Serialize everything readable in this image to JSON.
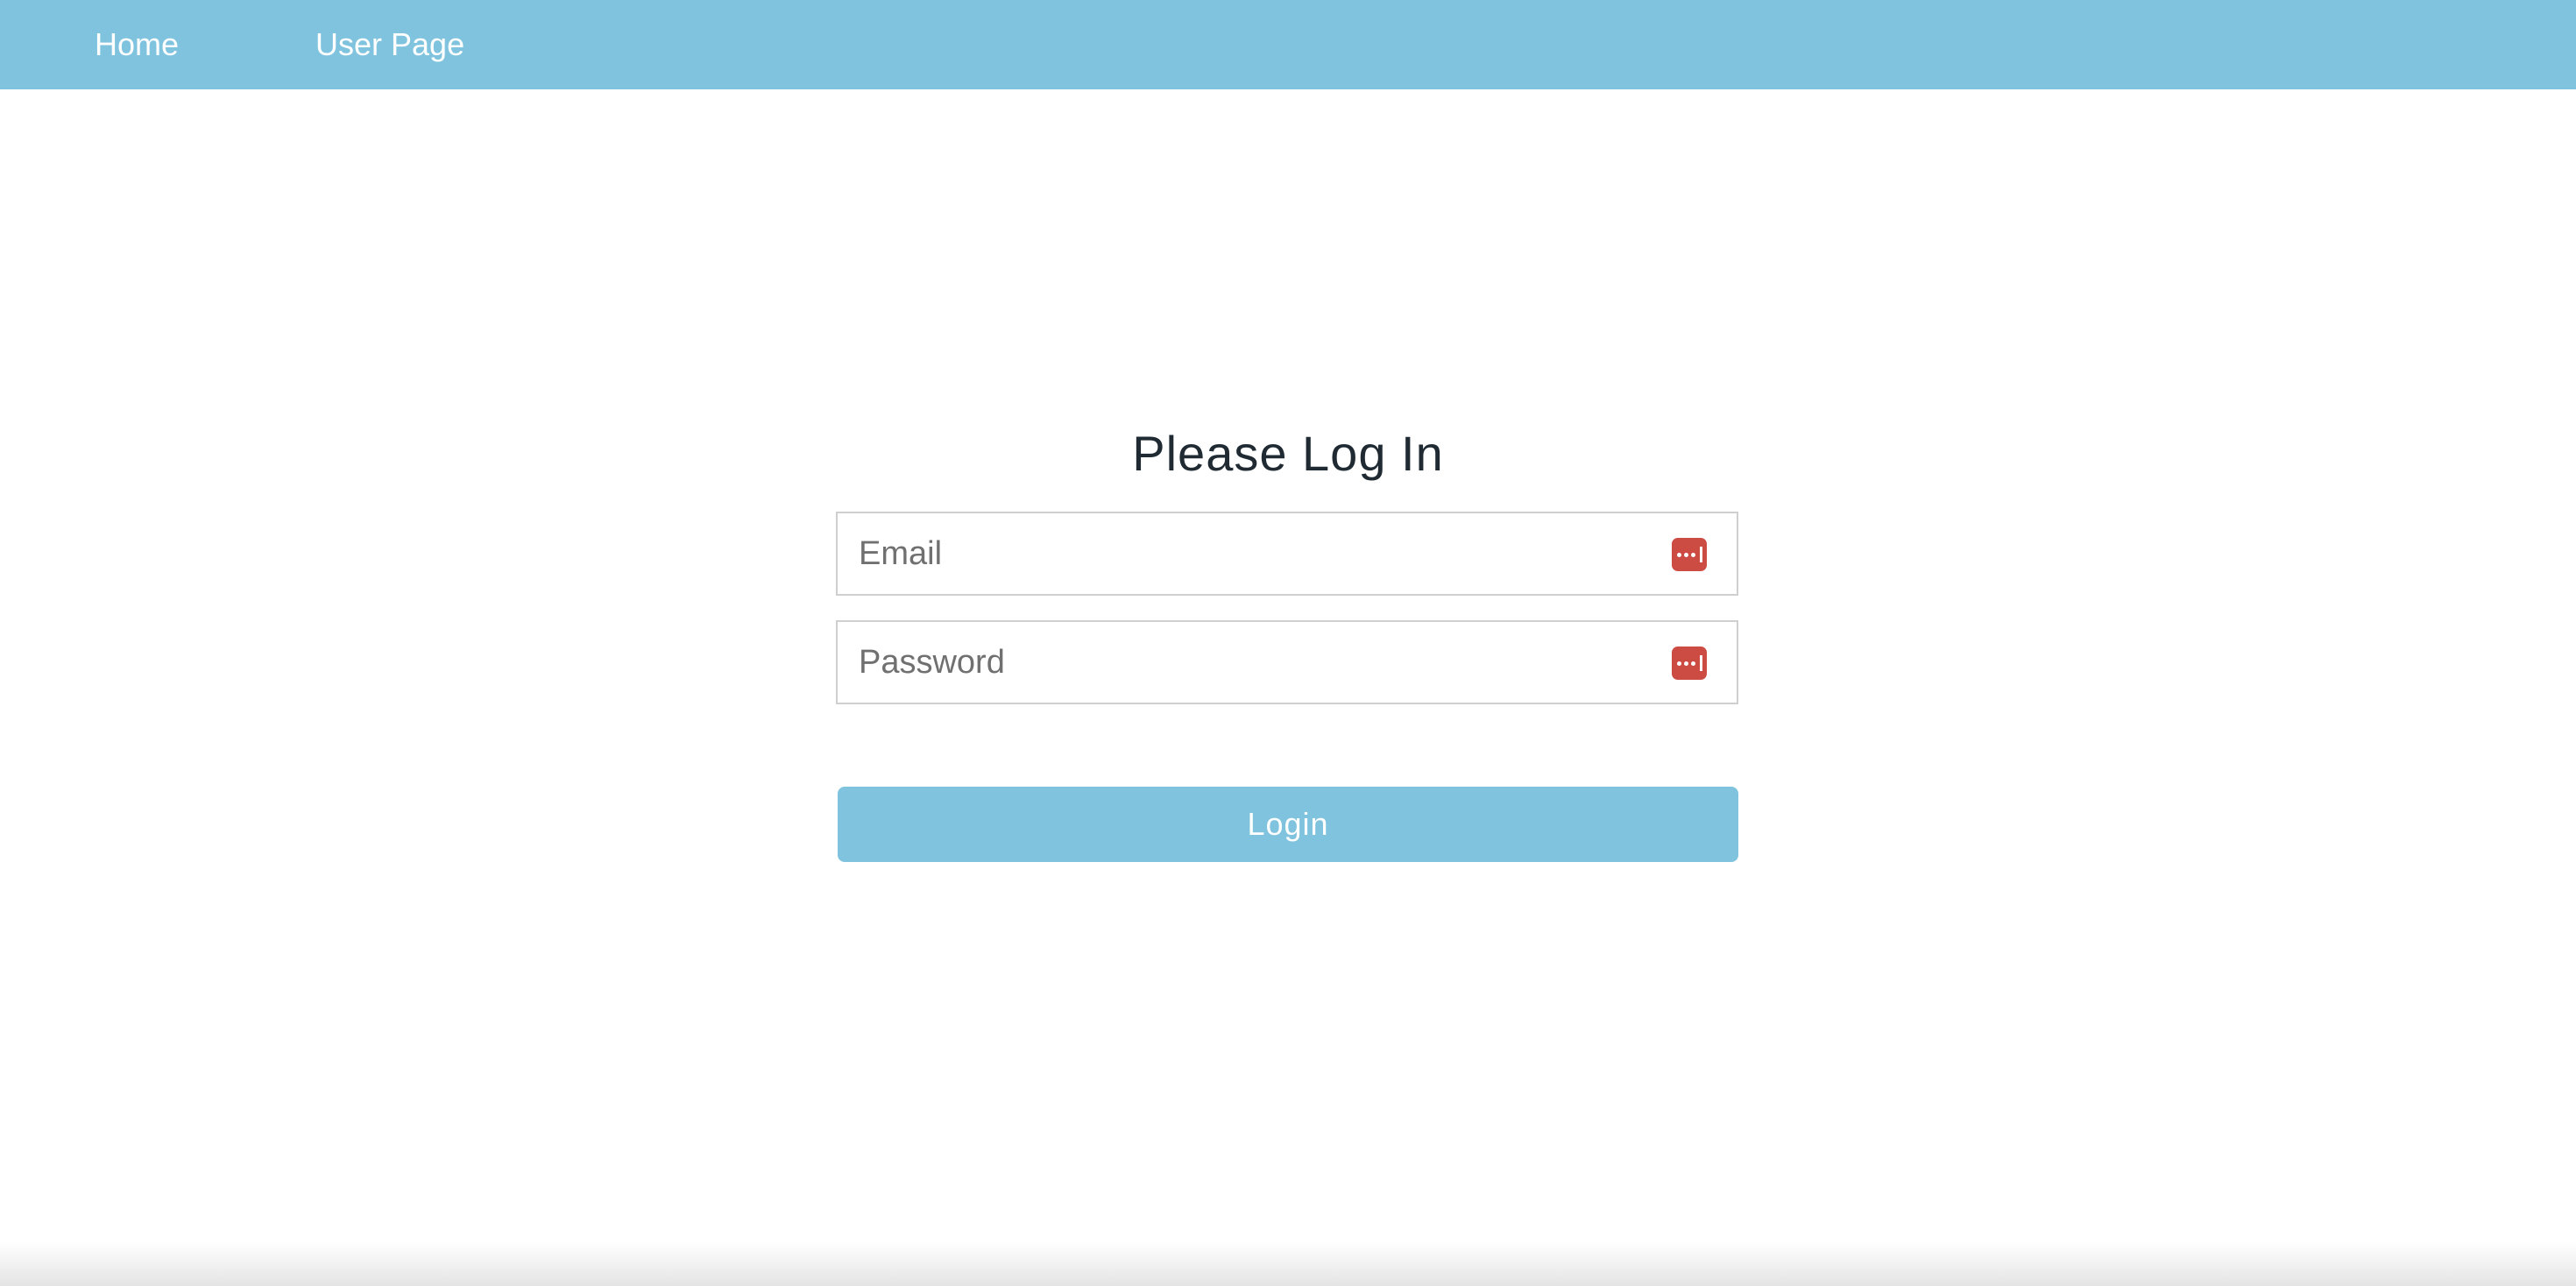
{
  "navbar": {
    "links": [
      {
        "label": "Home"
      },
      {
        "label": "User Page"
      }
    ],
    "color": "#7fc3de"
  },
  "login": {
    "title": "Please Log In",
    "email": {
      "value": "",
      "placeholder": "Email",
      "icon": "password-manager-icon"
    },
    "password": {
      "value": "",
      "placeholder": "Password",
      "icon": "password-manager-icon"
    },
    "submit_label": "Login",
    "button_color": "#7fc3de",
    "icon_color": "#cc4b43"
  }
}
